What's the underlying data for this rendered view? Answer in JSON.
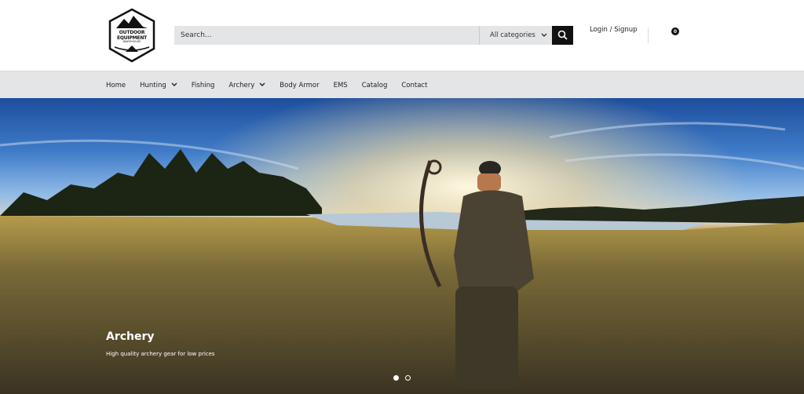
{
  "logo": {
    "name": "OUTDOOR EQUIPMENT",
    "sub": "WAREHOUSE"
  },
  "search": {
    "placeholder": "Search...",
    "category": "All categories"
  },
  "account": {
    "login_label": "Login / Signup"
  },
  "cart": {
    "count": "0"
  },
  "nav": {
    "items": [
      {
        "label": "Home",
        "dropdown": false
      },
      {
        "label": "Hunting",
        "dropdown": true
      },
      {
        "label": "Fishing",
        "dropdown": false
      },
      {
        "label": "Archery",
        "dropdown": true
      },
      {
        "label": "Body Armor",
        "dropdown": false
      },
      {
        "label": "EMS",
        "dropdown": false
      },
      {
        "label": "Catalog",
        "dropdown": false
      },
      {
        "label": "Contact",
        "dropdown": false
      }
    ]
  },
  "hero": {
    "title": "Archery",
    "subtitle": "High quality archery gear for low prices",
    "slide_count": 2,
    "active_slide": 1
  },
  "colors": {
    "accent": "#111111",
    "nav_bg": "#e4e5e7"
  }
}
